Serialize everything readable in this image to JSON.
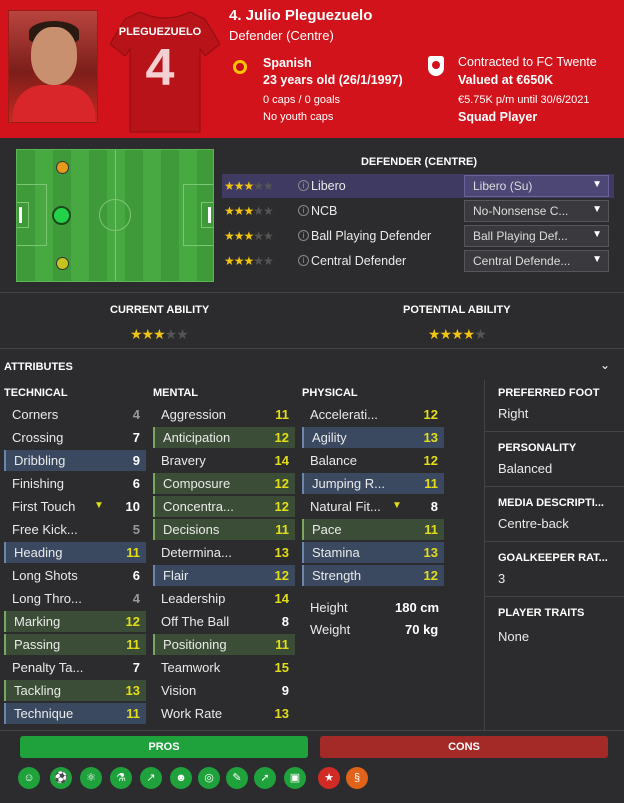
{
  "player": {
    "name": "4. Julio Pleguezuelo",
    "position": "Defender (Centre)",
    "shirt_name": "PLEGUEZUELO",
    "shirt_number": "4",
    "nationality": "Spanish",
    "age": "23 years old (26/1/1997)",
    "caps": "0 caps / 0 goals",
    "youth_caps": "No youth caps"
  },
  "contract": {
    "club": "Contracted to FC Twente",
    "value": "Valued at €650K",
    "wage": "€5.75K p/m until 30/6/2021",
    "status": "Squad Player"
  },
  "roles": {
    "title": "DEFENDER (CENTRE)",
    "items": [
      {
        "name": "Libero",
        "stars": 3,
        "duty": "Libero (Su)"
      },
      {
        "name": "NCB",
        "stars": 3,
        "duty": "No-Nonsense C..."
      },
      {
        "name": "Ball Playing Defender",
        "stars": 3,
        "duty": "Ball Playing Def..."
      },
      {
        "name": "Central Defender",
        "stars": 3,
        "duty": "Central Defende..."
      }
    ]
  },
  "ability": {
    "current_label": "CURRENT ABILITY",
    "current_stars": 3,
    "potential_label": "POTENTIAL ABILITY",
    "potential_stars": 4
  },
  "attributes": {
    "title": "ATTRIBUTES",
    "technical_label": "TECHNICAL",
    "mental_label": "MENTAL",
    "physical_label": "PHYSICAL",
    "technical": [
      {
        "name": "Corners",
        "value": "4",
        "hl": "none",
        "color": "grey"
      },
      {
        "name": "Crossing",
        "value": "7",
        "hl": "none",
        "color": "white"
      },
      {
        "name": "Dribbling",
        "value": "9",
        "hl": "blue",
        "color": "white"
      },
      {
        "name": "Finishing",
        "value": "6",
        "hl": "none",
        "color": "white"
      },
      {
        "name": "First Touch",
        "value": "10",
        "hl": "none",
        "color": "white",
        "arrow": true
      },
      {
        "name": "Free Kick...",
        "value": "5",
        "hl": "none",
        "color": "grey"
      },
      {
        "name": "Heading",
        "value": "11",
        "hl": "blue",
        "color": "yellow"
      },
      {
        "name": "Long Shots",
        "value": "6",
        "hl": "none",
        "color": "white"
      },
      {
        "name": "Long Thro...",
        "value": "4",
        "hl": "none",
        "color": "grey"
      },
      {
        "name": "Marking",
        "value": "12",
        "hl": "green",
        "color": "yellow"
      },
      {
        "name": "Passing",
        "value": "11",
        "hl": "green",
        "color": "yellow"
      },
      {
        "name": "Penalty Ta...",
        "value": "7",
        "hl": "none",
        "color": "white"
      },
      {
        "name": "Tackling",
        "value": "13",
        "hl": "green",
        "color": "yellow"
      },
      {
        "name": "Technique",
        "value": "11",
        "hl": "blue",
        "color": "yellow"
      }
    ],
    "mental": [
      {
        "name": "Aggression",
        "value": "11",
        "hl": "none",
        "color": "yellow"
      },
      {
        "name": "Anticipation",
        "value": "12",
        "hl": "green",
        "color": "yellow"
      },
      {
        "name": "Bravery",
        "value": "14",
        "hl": "none",
        "color": "yellow"
      },
      {
        "name": "Composure",
        "value": "12",
        "hl": "green",
        "color": "yellow"
      },
      {
        "name": "Concentra...",
        "value": "12",
        "hl": "green",
        "color": "yellow"
      },
      {
        "name": "Decisions",
        "value": "11",
        "hl": "green",
        "color": "yellow"
      },
      {
        "name": "Determina...",
        "value": "13",
        "hl": "none",
        "color": "yellow"
      },
      {
        "name": "Flair",
        "value": "12",
        "hl": "blue",
        "color": "yellow"
      },
      {
        "name": "Leadership",
        "value": "14",
        "hl": "none",
        "color": "yellow"
      },
      {
        "name": "Off The Ball",
        "value": "8",
        "hl": "none",
        "color": "white"
      },
      {
        "name": "Positioning",
        "value": "11",
        "hl": "green",
        "color": "yellow"
      },
      {
        "name": "Teamwork",
        "value": "15",
        "hl": "none",
        "color": "yellow"
      },
      {
        "name": "Vision",
        "value": "9",
        "hl": "none",
        "color": "white"
      },
      {
        "name": "Work Rate",
        "value": "13",
        "hl": "none",
        "color": "yellow"
      }
    ],
    "physical": [
      {
        "name": "Accelerati...",
        "value": "12",
        "hl": "none",
        "color": "yellow"
      },
      {
        "name": "Agility",
        "value": "13",
        "hl": "blue",
        "color": "yellow"
      },
      {
        "name": "Balance",
        "value": "12",
        "hl": "none",
        "color": "yellow"
      },
      {
        "name": "Jumping R...",
        "value": "11",
        "hl": "blue",
        "color": "yellow"
      },
      {
        "name": "Natural Fit...",
        "value": "8",
        "hl": "none",
        "color": "white",
        "arrow": true
      },
      {
        "name": "Pace",
        "value": "11",
        "hl": "green",
        "color": "yellow"
      },
      {
        "name": "Stamina",
        "value": "13",
        "hl": "blue",
        "color": "yellow"
      },
      {
        "name": "Strength",
        "value": "12",
        "hl": "blue",
        "color": "yellow"
      }
    ],
    "height_label": "Height",
    "height": "180 cm",
    "weight_label": "Weight",
    "weight": "70 kg"
  },
  "side": {
    "foot_label": "PREFERRED FOOT",
    "foot": "Right",
    "personality_label": "PERSONALITY",
    "personality": "Balanced",
    "media_label": "MEDIA DESCRIPTI...",
    "media": "Centre-back",
    "gk_label": "GOALKEEPER RAT...",
    "gk": "3",
    "traits_label": "PLAYER TRAITS",
    "traits": "None"
  },
  "footer": {
    "pros": "PROS",
    "cons": "CONS"
  },
  "colors": {
    "header": "#d3131b",
    "pros": "#1fa23c",
    "cons": "#a42a27",
    "star": "#f1c40f",
    "value_yellow": "#e3dd18"
  }
}
